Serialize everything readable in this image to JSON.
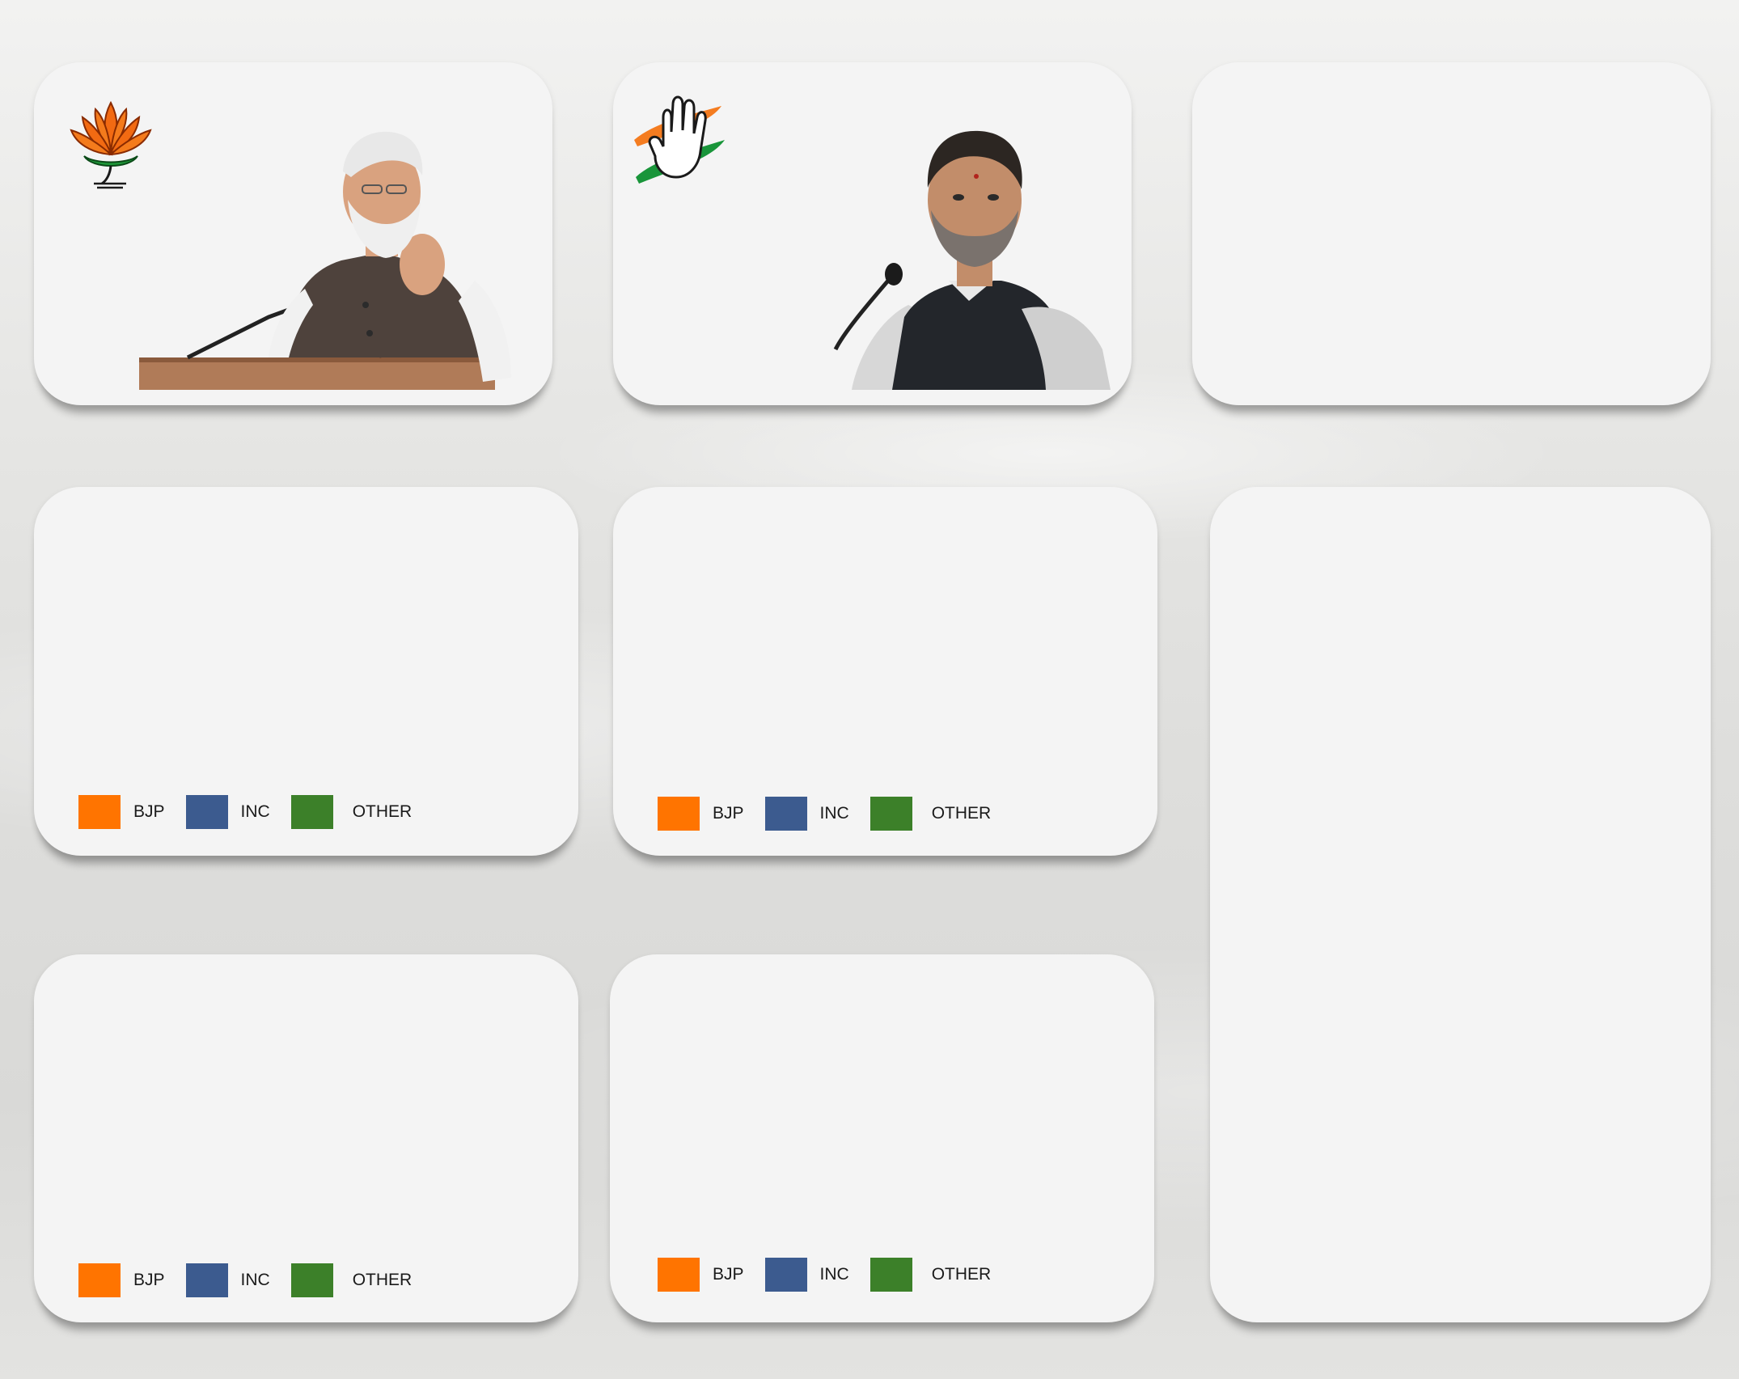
{
  "legend": {
    "items": [
      {
        "label": "BJP",
        "color": "#ff7400"
      },
      {
        "label": "INC",
        "color": "#3c5b8f"
      },
      {
        "label": "OTHER",
        "color": "#3c8029"
      }
    ]
  },
  "cards": {
    "bjp_card": {
      "logo": "lotus-logo-icon",
      "photo": "bjp-leader-photo"
    },
    "inc_card": {
      "logo": "hand-logo-icon",
      "photo": "inc-leader-photo"
    }
  }
}
